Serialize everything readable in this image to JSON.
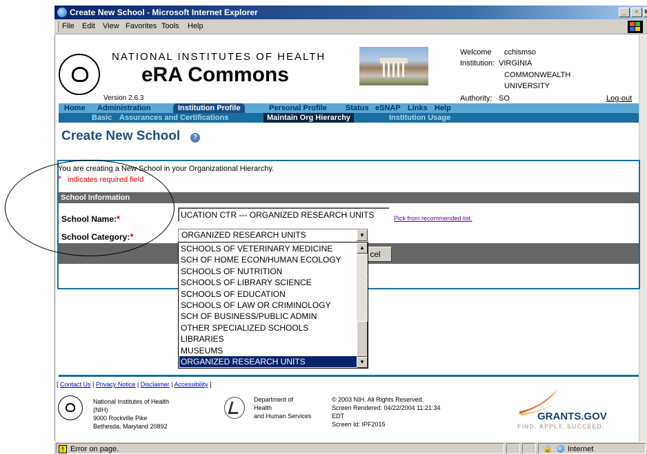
{
  "window": {
    "title": "Create New School - Microsoft Internet Explorer",
    "min_label": "_",
    "max_label": "▫",
    "close_label": "×"
  },
  "menu": [
    "File",
    "Edit",
    "View",
    "Favorites",
    "Tools",
    "Help"
  ],
  "header": {
    "agency": "NATIONAL INSTITUTES OF HEALTH",
    "app": "eRA Commons",
    "version": "Version 2.6.3",
    "welcome_label": "Welcome",
    "welcome_user": "cchismso",
    "institution_label": "Institution:",
    "institution_lines": [
      "VIRGINIA",
      "COMMONWEALTH",
      "UNIVERSITY"
    ],
    "authority_label": "Authority:",
    "authority_value": "SO",
    "logout": "Log-out"
  },
  "nav_primary": [
    "Home",
    "Administration",
    "Institution Profile",
    "Personal Profile",
    "Status",
    "eSNAP",
    "Links",
    "Help"
  ],
  "nav_secondary": [
    "Basic",
    "Assurances and Certifications",
    "Maintain Org Hierarchy",
    "Institution Usage"
  ],
  "page": {
    "title": "Create New School",
    "help_glyph": "?",
    "intro": "You are creating a New School in your Organizational Hierarchy.",
    "required_star": "*",
    "required_note": "indicates required field",
    "section": "School Information"
  },
  "form": {
    "name_label": "School Name:",
    "name_value": "UCATION CTR --- ORGANIZED RESEARCH UNITS",
    "pick_link": "Pick from recommended list.",
    "category_label": "School Category:",
    "category_value": "ORGANIZED RESEARCH UNITS",
    "cancel_label": "cel"
  },
  "dropdown_options": [
    "SCHOOLS OF VETERINARY MEDICINE",
    "SCH OF HOME ECON/HUMAN ECOLOGY",
    "SCHOOLS OF NUTRITION",
    "SCHOOLS OF LIBRARY SCIENCE",
    "SCHOOLS OF EDUCATION",
    "SCHOOLS OF LAW OR CRIMINOLOGY",
    "SCH OF BUSINESS/PUBLIC ADMIN",
    "OTHER SPECIALIZED SCHOOLS",
    "LIBRARIES",
    "MUSEUMS",
    "ORGANIZED RESEARCH UNITS"
  ],
  "footer": {
    "links": [
      "Contact Us",
      "Privacy Notice",
      "Disclaimer",
      "Accessibility"
    ],
    "nih_lines": [
      "National Institutes of Health",
      "(NIH)",
      "9000 Rockville Pike",
      "Bethesda, Maryland 20892"
    ],
    "hhs_lines": [
      "Department of",
      "Health",
      "and Human Services"
    ],
    "info_lines": [
      "© 2003 NIH. All Rights Reserved.",
      "Screen Rendered: 04/22/2004 11:21:34",
      "EDT",
      "Screen Id: IPF2015"
    ],
    "grants_name": "GRANTS.GOV",
    "grants_tagline": "FIND. APPLY. SUCCEED."
  },
  "status": {
    "message": "Error on page.",
    "zone": "Internet"
  },
  "colors": {
    "nav_primary_bg": "#5ba7d8",
    "nav_secondary_bg": "#1a6e9e",
    "title_blue": "#1f4f7a",
    "required_red": "#e00000",
    "selection": "#0a246a"
  }
}
